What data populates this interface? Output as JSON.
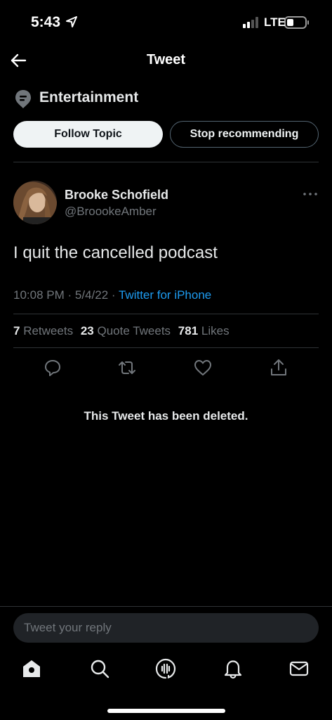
{
  "status_bar": {
    "time": "5:43",
    "network": "LTE"
  },
  "header": {
    "title": "Tweet"
  },
  "topic": {
    "name": "Entertainment",
    "follow_label": "Follow Topic",
    "stop_label": "Stop recommending"
  },
  "tweet": {
    "author_name": "Brooke Schofield",
    "author_handle": "@BroookeAmber",
    "text": "I quit the cancelled podcast",
    "time": "10:08 PM",
    "date": "5/4/22",
    "source": "Twitter for iPhone",
    "retweets_count": "7",
    "retweets_label": "Retweets",
    "quotes_count": "23",
    "quotes_label": "Quote Tweets",
    "likes_count": "781",
    "likes_label": "Likes"
  },
  "quoted": {
    "deleted_text": "This Tweet has been deleted."
  },
  "reply": {
    "placeholder": "Tweet your reply"
  },
  "icons": {
    "back": "arrow-left-icon",
    "topic": "topic-pin-icon",
    "more": "more-icon",
    "reply": "comment-icon",
    "retweet": "retweet-icon",
    "like": "heart-icon",
    "share": "share-icon",
    "tabs": [
      "home-icon",
      "search-icon",
      "spaces-icon",
      "bell-icon",
      "mail-icon"
    ]
  },
  "colors": {
    "background": "#000000",
    "accent": "#1d9bf0",
    "secondary_text": "#71767b",
    "divider": "#2f3336"
  }
}
